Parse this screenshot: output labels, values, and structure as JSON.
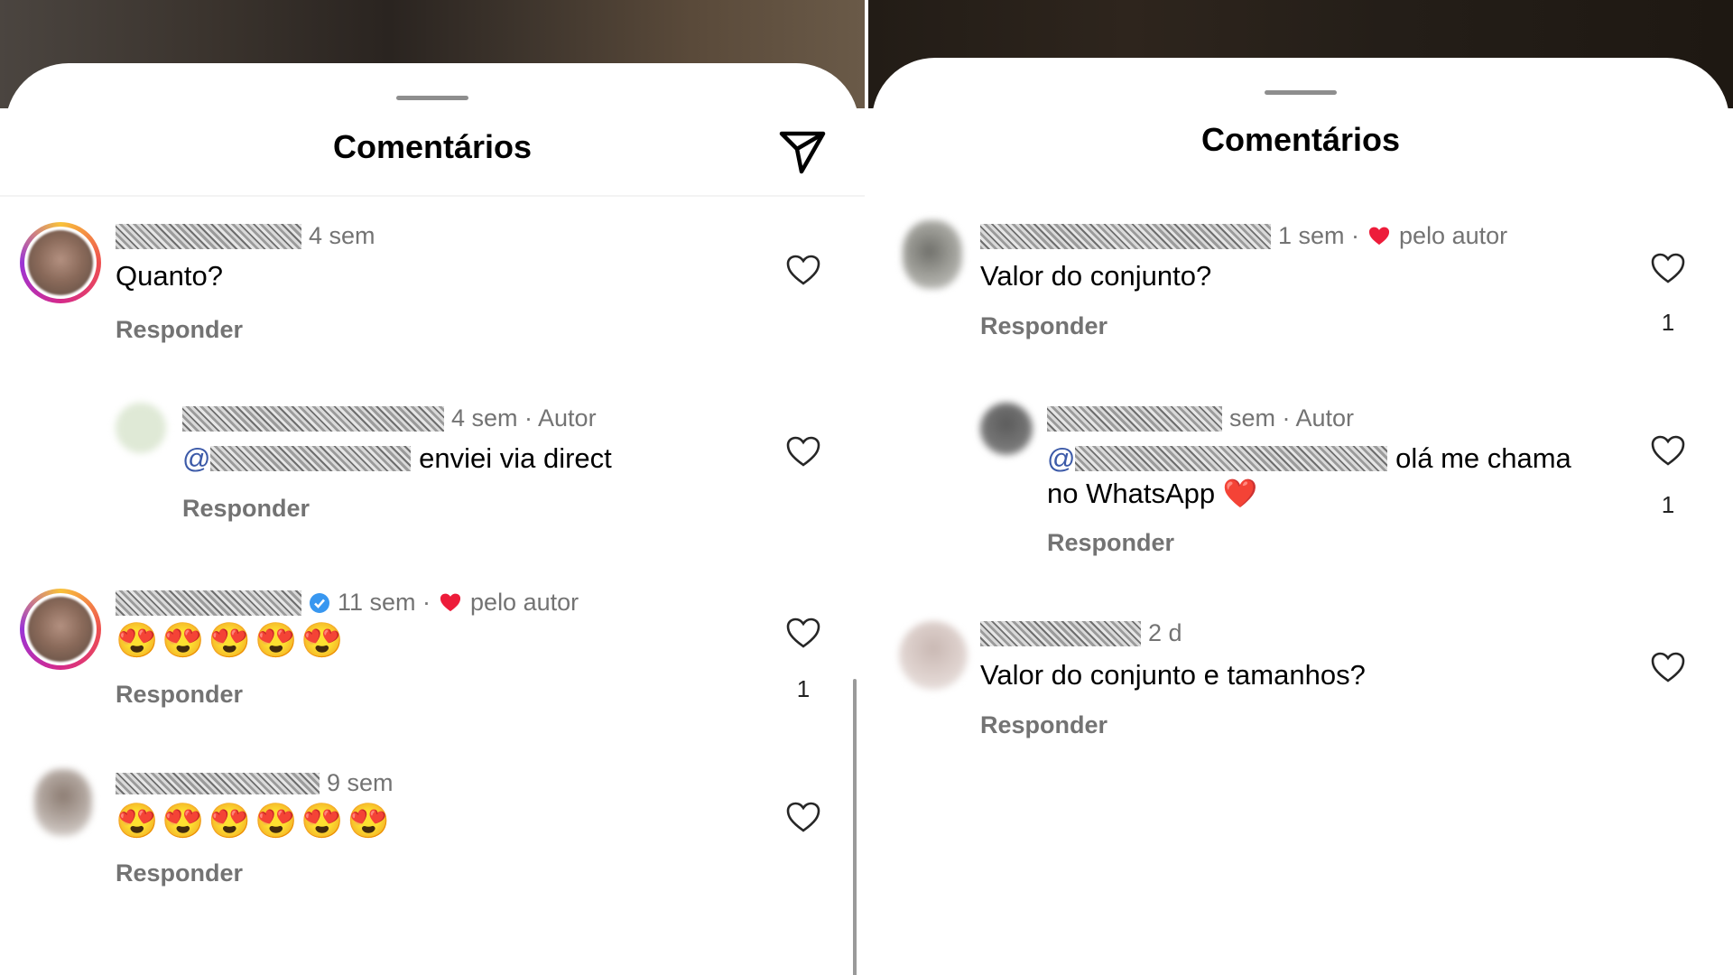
{
  "left": {
    "title": "Comentários",
    "comments": [
      {
        "time": "4 sem",
        "text": "Quanto?",
        "reply_label": "Responder"
      },
      {
        "time": "4 sem · Autor",
        "mention": "@",
        "text": " enviei via direct",
        "reply_label": "Responder"
      },
      {
        "time": "11 sem ·",
        "liked_label": "pelo autor",
        "text": "😍😍😍😍😍",
        "reply_label": "Responder",
        "likes": "1"
      },
      {
        "time": "9 sem",
        "text": "😍😍😍😍😍😍",
        "reply_label": "Responder"
      }
    ]
  },
  "right": {
    "title": "Comentários",
    "comments": [
      {
        "time": "1 sem ·",
        "liked_label": "pelo autor",
        "text": "Valor do conjunto?",
        "reply_label": "Responder",
        "likes": "1"
      },
      {
        "time": "sem · Autor",
        "mention": "@",
        "text_line1": " olá me chama",
        "text_line2": "no WhatsApp ❤️",
        "reply_label": "Responder",
        "likes": "1"
      },
      {
        "time": "2 d",
        "text": "Valor do conjunto e tamanhos?",
        "reply_label": "Responder"
      }
    ]
  },
  "colors": {
    "meta_gray": "#737373",
    "mention_blue": "#3c5aa8",
    "heart_red": "#ed1c3a",
    "verified_blue": "#3897f0"
  },
  "icons": [
    "send-icon",
    "heart-outline-icon",
    "heart-filled-icon",
    "verified-badge-icon"
  ]
}
